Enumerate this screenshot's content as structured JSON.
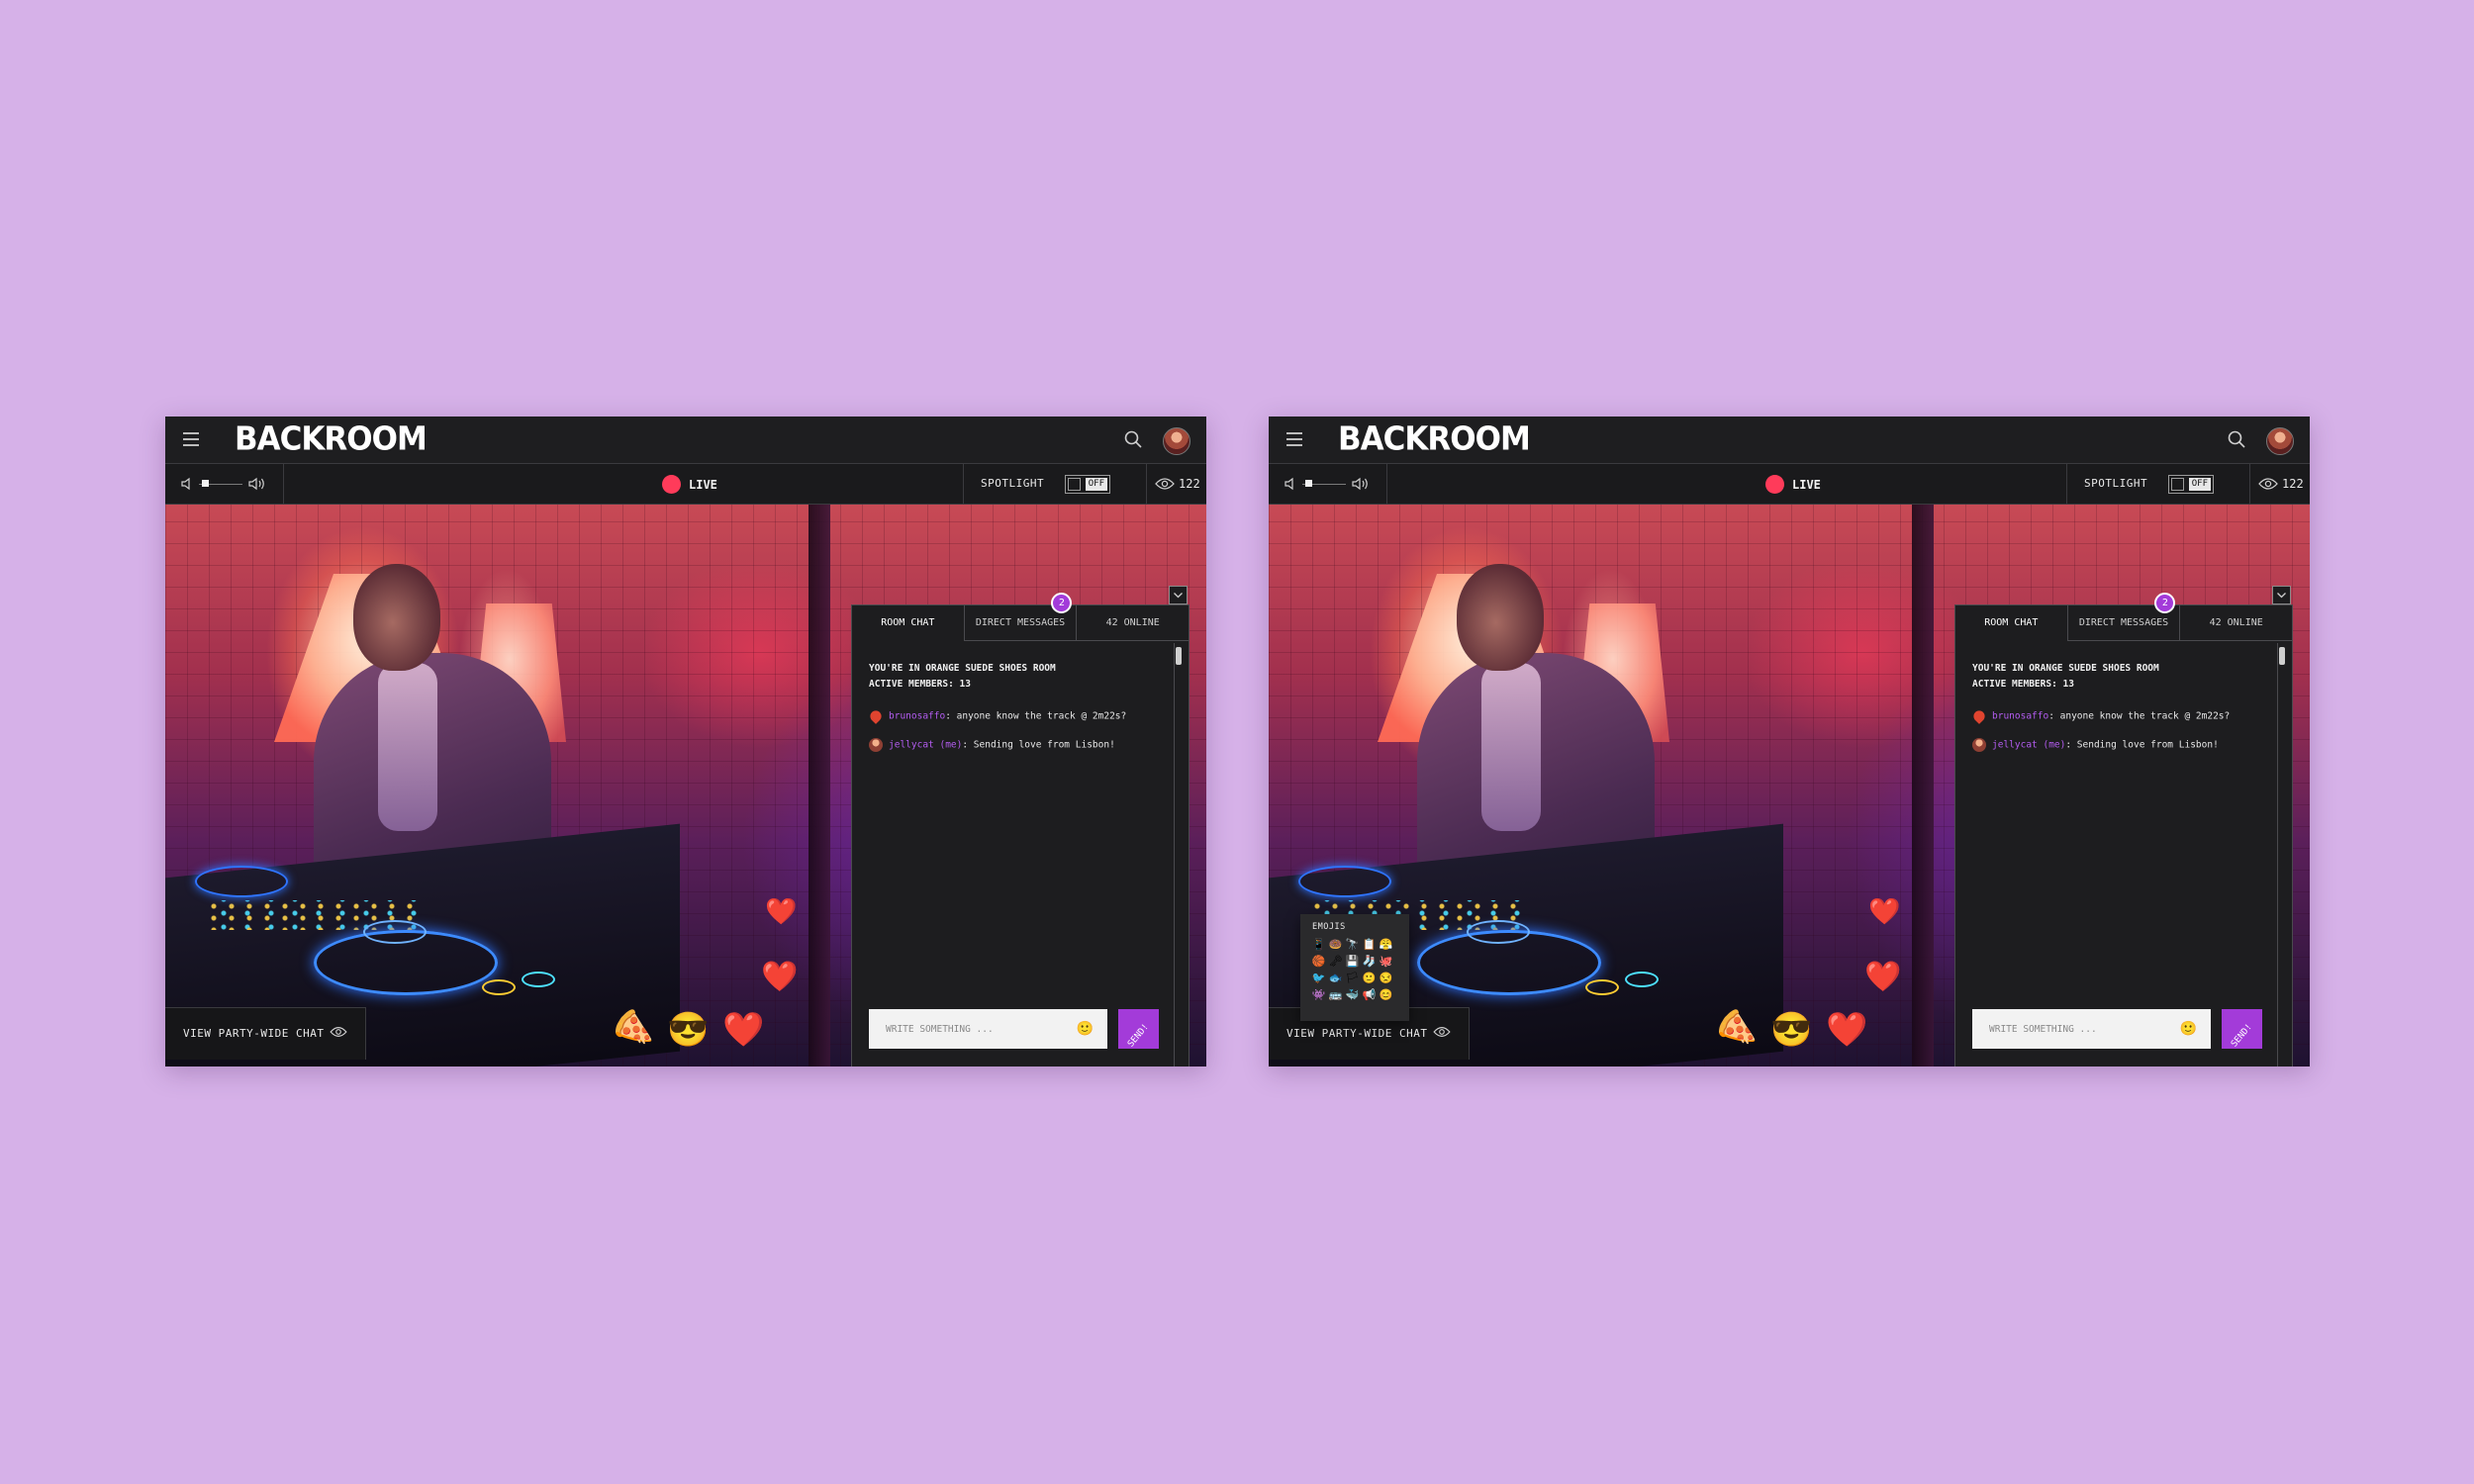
{
  "app": {
    "logo": "BACKROOM",
    "live_label": "LIVE",
    "spotlight_label": "SPOTLIGHT",
    "spotlight_state": "OFF",
    "viewer_count": "122",
    "party_chat_label": "VIEW PARTY-WIDE CHAT"
  },
  "chat": {
    "tabs": [
      "ROOM CHAT",
      "DIRECT MESSAGES",
      "42 ONLINE"
    ],
    "dm_badge": "2",
    "room_line1": "YOU'RE IN ORANGE SUEDE SHOES ROOM",
    "room_line2": "ACTIVE MEMBERS: 13",
    "messages": [
      {
        "user": "brunosaffo",
        "text": ": anyone know the track @ 2m22s?"
      },
      {
        "user": "jellycat (me)",
        "text": ": Sending love from Lisbon!"
      }
    ],
    "input_placeholder": "WRITE SOMETHING ...",
    "send_label": "SEND!",
    "emoji_button": "🙂"
  },
  "emoji_picker": {
    "title": "EMOJIS",
    "emojis": [
      "📱",
      "🍩",
      "🔭",
      "📋",
      "😤",
      "🏀",
      "🗝",
      "💾",
      "🧦",
      "🐙",
      "🐦",
      "🐟",
      "🏳",
      "🙂",
      "😒",
      "👾",
      "🚌",
      "🐳",
      "📢",
      "😊"
    ]
  },
  "floating_reactions": [
    "🍕",
    "😎",
    "❤️",
    "❤️",
    "❤️"
  ],
  "colors": {
    "background": "#d6b1e8",
    "accent": "#a33bd9",
    "live": "#ff3b5a",
    "username": "#b35cf0"
  }
}
